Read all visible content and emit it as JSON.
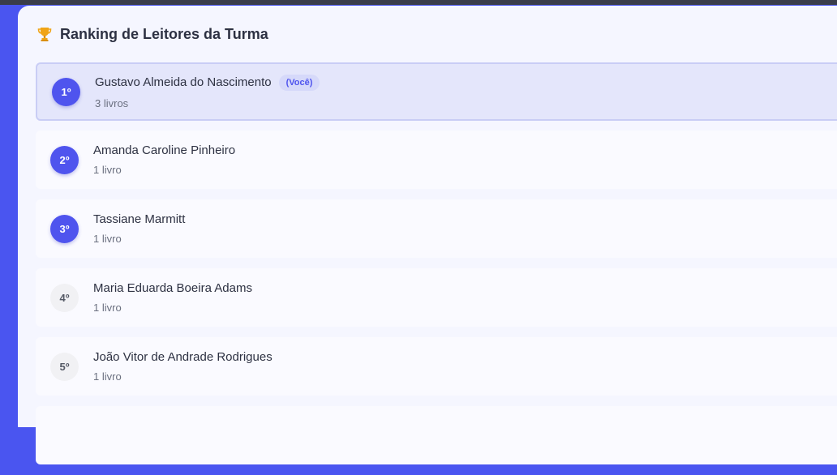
{
  "header": {
    "title": "Ranking de Leitores da Turma",
    "icon": "trophy-icon"
  },
  "colors": {
    "accent": "#4f54ee",
    "trophy": "#f0a416",
    "background": "#4a55f0"
  },
  "ranking": [
    {
      "rank": "1º",
      "name": "Gustavo Almeida do Nascimento",
      "badge": "(Você)",
      "count": "3 livros"
    },
    {
      "rank": "2º",
      "name": "Amanda Caroline Pinheiro",
      "count": "1 livro"
    },
    {
      "rank": "3º",
      "name": "Tassiane Marmitt",
      "count": "1 livro"
    },
    {
      "rank": "4º",
      "name": "Maria Eduarda Boeira Adams",
      "count": "1 livro"
    },
    {
      "rank": "5º",
      "name": "João Vitor de Andrade Rodrigues",
      "count": "1 livro"
    }
  ]
}
